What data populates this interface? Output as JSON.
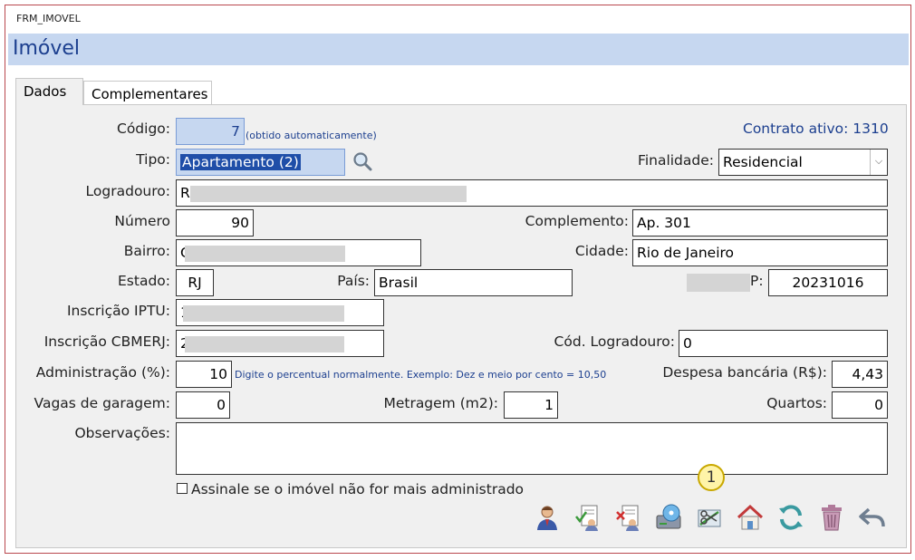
{
  "window": {
    "title": "FRM_IMOVEL"
  },
  "header": {
    "title": "Imóvel"
  },
  "tabs": [
    {
      "label": "Dados"
    },
    {
      "label": "Complementares"
    }
  ],
  "contract": {
    "text": "Contrato ativo: 1310"
  },
  "form": {
    "codigo": {
      "label": "Código:",
      "value": "7",
      "hint": "(obtido automaticamente)"
    },
    "tipo": {
      "label": "Tipo:",
      "value": "Apartamento (2)"
    },
    "finalidade": {
      "label": "Finalidade:",
      "value": "Residencial"
    },
    "logradouro": {
      "label": "Logradouro:",
      "value": "Ru"
    },
    "numero": {
      "label": "Número",
      "value": "90"
    },
    "complemento": {
      "label": "Complemento:",
      "value": "Ap. 301"
    },
    "bairro": {
      "label": "Bairro:",
      "value": "C"
    },
    "cidade": {
      "label": "Cidade:",
      "value": "Rio de Janeiro"
    },
    "estado": {
      "label": "Estado:",
      "value": "RJ"
    },
    "pais": {
      "label": "País:",
      "value": "Brasil"
    },
    "cep": {
      "label": "P:",
      "value": "20231016"
    },
    "iptu": {
      "label": "Inscrição IPTU:",
      "value": "1"
    },
    "cbmerj": {
      "label": "Inscrição CBMERJ:",
      "value": "2"
    },
    "cod_logradouro": {
      "label": "Cód. Logradouro:",
      "value": "0"
    },
    "administracao": {
      "label": "Administração (%):",
      "value": "10",
      "hint": "Digite o percentual normalmente. Exemplo: Dez e meio por cento = 10,50"
    },
    "despesa": {
      "label": "Despesa bancária (R$):",
      "value": "4,43"
    },
    "vagas": {
      "label": "Vagas de garagem:",
      "value": "0"
    },
    "metragem": {
      "label": "Metragem (m2):",
      "value": "1"
    },
    "quartos": {
      "label": "Quartos:",
      "value": "0"
    },
    "observacoes": {
      "label": "Observações:",
      "value": ""
    },
    "nao_administrado": {
      "label": "Assinale se o imóvel não for mais administrado",
      "checked": false
    }
  },
  "badge": {
    "text": "1"
  },
  "toolbar": {
    "icons": [
      "owner-icon",
      "approve-document-icon",
      "reject-document-icon",
      "disk-icon",
      "cut-document-icon",
      "house-icon",
      "refresh-icon",
      "trash-icon",
      "undo-icon"
    ]
  }
}
